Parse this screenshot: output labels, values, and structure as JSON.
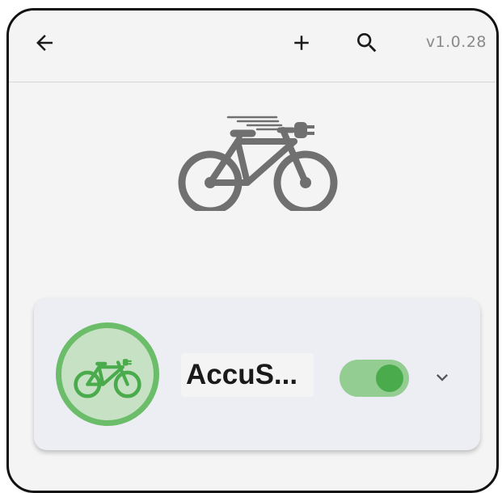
{
  "header": {
    "back_icon": "arrow-left-icon",
    "add_icon": "plus-icon",
    "search_icon": "search-icon",
    "version": "v1.0.28"
  },
  "hero": {
    "icon": "electric-bike-icon",
    "color": "#707070"
  },
  "device_card": {
    "avatar_icon": "electric-bike-icon",
    "avatar_color": "#49ab4b",
    "name": "AccuS...",
    "toggle_on": true,
    "toggle_color": "#49ab4b",
    "expand_icon": "chevron-down-icon"
  }
}
